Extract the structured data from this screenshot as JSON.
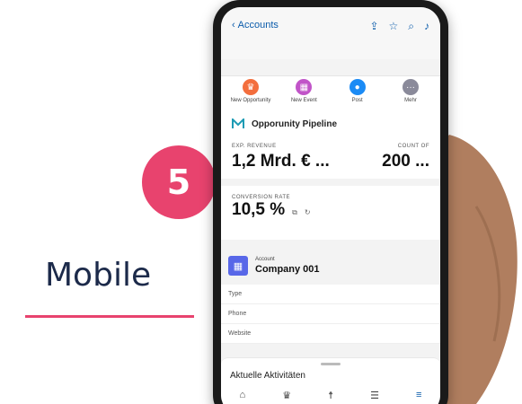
{
  "step_number": "5",
  "mobile_label": "Mobile",
  "header": {
    "back_label": "Accounts"
  },
  "actions": [
    {
      "label": "New Opportunity",
      "color": "#f36e3d",
      "icon": "crown-icon",
      "glyph": "♛"
    },
    {
      "label": "New Event",
      "color": "#c154c8",
      "icon": "calendar-icon",
      "glyph": "▦"
    },
    {
      "label": "Post",
      "color": "#1b8bf5",
      "icon": "chat-icon",
      "glyph": "●"
    },
    {
      "label": "Mehr",
      "color": "#8a8a9a",
      "icon": "more-icon",
      "glyph": "···"
    }
  ],
  "pipeline": {
    "title": "Opporunity Pipeline",
    "exp_revenue_label": "EXP. REVENUE",
    "exp_revenue_value": "1,2 Mrd. € ...",
    "count_label": "COUNT OF",
    "count_value": "200 ..."
  },
  "conversion": {
    "label": "CONVERSION RATE",
    "value": "10,5 %"
  },
  "account": {
    "label": "Account",
    "name": "Company 001",
    "fields": [
      "Type",
      "Phone",
      "Website"
    ]
  },
  "drawer": {
    "title": "Aktuelle Aktivitäten"
  },
  "colors": {
    "accent": "#e8436e",
    "brand_blue": "#0b5cab",
    "navy": "#1c2a4a"
  }
}
